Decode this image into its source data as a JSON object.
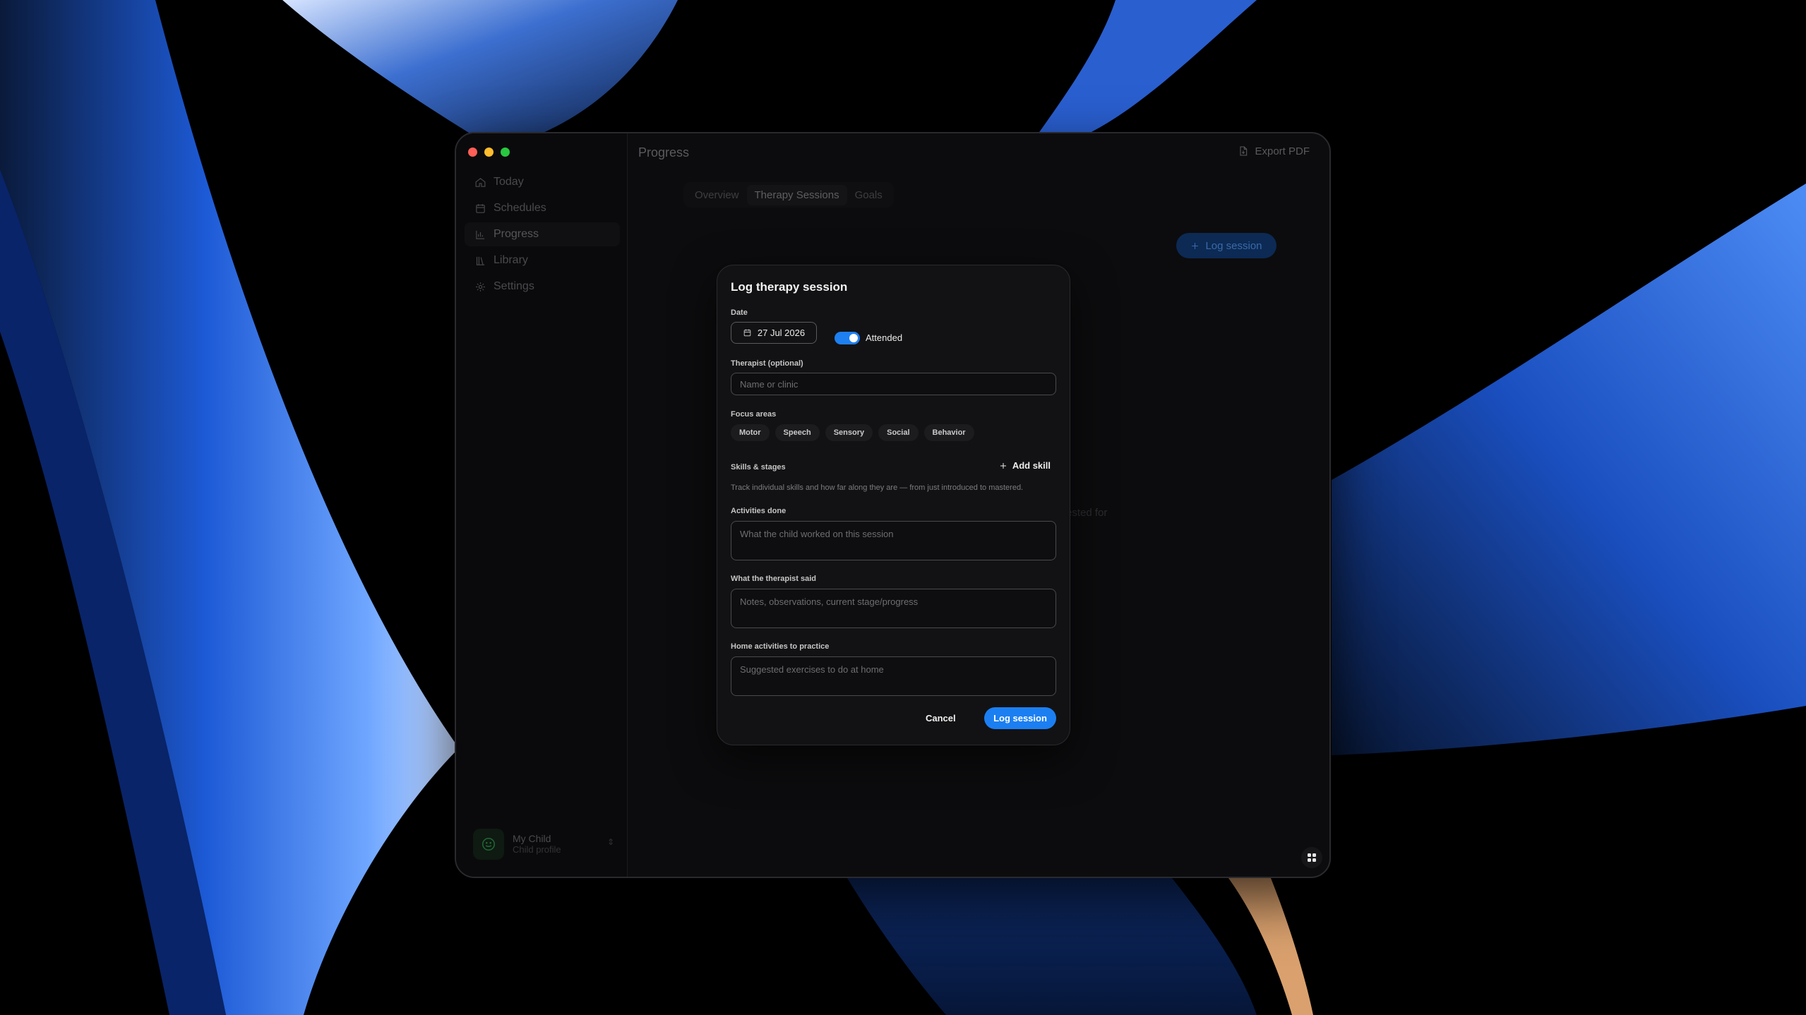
{
  "window": {
    "header_title": "Progress",
    "export_label": "Export PDF"
  },
  "sidebar": {
    "items": [
      {
        "label": "Today",
        "icon": "home-icon"
      },
      {
        "label": "Schedules",
        "icon": "calendar-icon"
      },
      {
        "label": "Progress",
        "icon": "chart-icon",
        "active": true
      },
      {
        "label": "Library",
        "icon": "books-icon"
      },
      {
        "label": "Settings",
        "icon": "gear-icon"
      }
    ],
    "profile": {
      "name": "My Child",
      "subtitle": "Child profile",
      "icon": "smile-icon"
    }
  },
  "tabs": [
    {
      "label": "Overview"
    },
    {
      "label": "Therapy Sessions",
      "active": true
    },
    {
      "label": "Goals"
    }
  ],
  "background": {
    "log_button": "Log session",
    "partial_text": "ested for"
  },
  "modal": {
    "title": "Log therapy session",
    "date_label": "Date",
    "date_value": "27 Jul 2026",
    "attended_label": "Attended",
    "attended": true,
    "therapist_label": "Therapist (optional)",
    "therapist_placeholder": "Name or clinic",
    "focus_label": "Focus areas",
    "focus_areas": [
      "Motor",
      "Speech",
      "Sensory",
      "Social",
      "Behavior"
    ],
    "skills_label": "Skills & stages",
    "add_skill": "Add skill",
    "skills_helper": "Track individual skills and how far along they are — from just introduced to mastered.",
    "activities_label": "Activities done",
    "activities_placeholder": "What the child worked on this session",
    "therapist_said_label": "What the therapist said",
    "therapist_said_placeholder": "Notes, observations, current stage/progress",
    "home_label": "Home activities to practice",
    "home_placeholder": "Suggested exercises to do at home",
    "cancel": "Cancel",
    "submit": "Log session"
  },
  "colors": {
    "accent": "#1b7ff2",
    "traffic_red": "#ff5f57",
    "traffic_yellow": "#febc2e",
    "traffic_green": "#28c840"
  }
}
